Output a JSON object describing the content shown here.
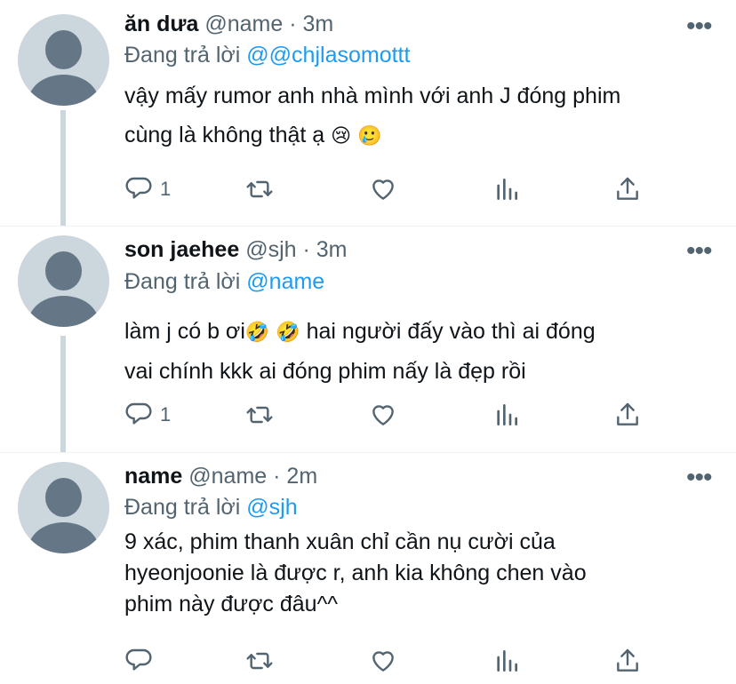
{
  "tweets": [
    {
      "name": "ăn dưa",
      "handle": "@name",
      "dot": "·",
      "time": "3m",
      "reply_prefix": "Đang trả lời",
      "reply_to": "@@chjlasomottt",
      "line1": "vậy mấy rumor anh nhà mình với anh J đóng phim",
      "line2": "cùng là không thật ạ",
      "emojis": [
        "😢",
        "🥲"
      ],
      "reply_count": "1"
    },
    {
      "name": "son jaehee",
      "handle": "@sjh",
      "dot": "·",
      "time": "3m",
      "reply_prefix": "Đang trả lời",
      "reply_to": "@name",
      "line1": "làm j có b ơi",
      "emojis": [
        "🤣",
        "🤣"
      ],
      "line1_tail": "hai người đấy vào thì ai đóng",
      "line2": "vai chính kkk ai đóng phim nấy là đẹp rồi",
      "reply_count": "1"
    },
    {
      "name": "name",
      "handle": "@name",
      "dot": "·",
      "time": "2m",
      "reply_prefix": "Đang trả lời",
      "reply_to": "@sjh",
      "line1": "9 xác, phim thanh xuân chỉ cần nụ cười của",
      "line2": "hyeonjoonie là được r, anh kia không chen vào",
      "line3": "phim này được đâu^^"
    }
  ],
  "icons": {
    "reply": "reply-icon",
    "retweet": "retweet-icon",
    "like": "like-icon",
    "analytics": "analytics-icon",
    "share": "share-icon",
    "more": "more-icon"
  },
  "more_label": "•••",
  "colors": {
    "accent": "#1d9bf0",
    "secondary_text": "#536471",
    "avatar_bg": "#ccd6dd",
    "avatar_fg": "#657786"
  }
}
